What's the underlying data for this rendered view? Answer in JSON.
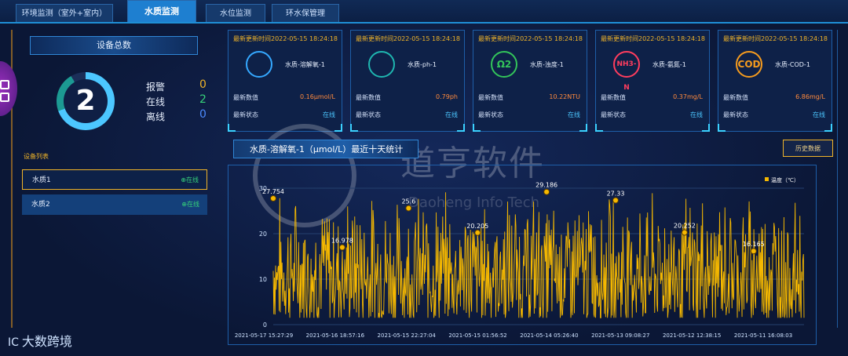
{
  "tabs": [
    {
      "label": "环境监测（室外+室内）",
      "active": false
    },
    {
      "label": "水质监测",
      "active": true
    },
    {
      "label": "水位监测",
      "active": false
    },
    {
      "label": "环水保管理",
      "active": false
    }
  ],
  "left_panel": {
    "title": "设备总数",
    "total": "2",
    "stats": [
      {
        "label": "报警",
        "value": "0",
        "color": "#f0b429"
      },
      {
        "label": "在线",
        "value": "2",
        "color": "#36d27a"
      },
      {
        "label": "离线",
        "value": "0",
        "color": "#4c8bff"
      }
    ],
    "device_list_title": "设备列表",
    "devices": [
      {
        "name": "水质1",
        "status": "在线"
      },
      {
        "name": "水质2",
        "status": "在线"
      }
    ]
  },
  "cards": [
    {
      "time": "最新更新时间2022-05-15 18:24:18",
      "name": "水质-溶解氧-1",
      "icon": "water-drop-icon",
      "icon_text": "",
      "icon_color": "#35a8ff",
      "value_label": "最新数值",
      "value": "0.16μmol/L",
      "status_label": "最新状态",
      "status": "在线"
    },
    {
      "time": "最新更新时间2022-05-15 18:24:18",
      "name": "水质-ph-1",
      "icon": "ph-icon",
      "icon_text": "",
      "icon_color": "#1fb6b0",
      "value_label": "最新数值",
      "value": "0.79ph",
      "status_label": "最新状态",
      "status": "在线"
    },
    {
      "time": "最新更新时间2022-05-15 18:24:18",
      "name": "水质-浊度-1",
      "icon": "turbidity-icon",
      "icon_text": "Ω2",
      "icon_color": "#33c45a",
      "value_label": "最新数值",
      "value": "10.22NTU",
      "status_label": "最新状态",
      "status": "在线"
    },
    {
      "time": "最新更新时间2022-05-15 18:24:18",
      "name": "水质-氨氮-1",
      "icon": "ammonia-icon",
      "icon_text": "NH3-N",
      "icon_color": "#ff3d5e",
      "value_label": "最新数值",
      "value": "0.37mg/L",
      "status_label": "最新状态",
      "status": "在线"
    },
    {
      "time": "最新更新时间2022-05-15 18:24:18",
      "name": "水质-COD-1",
      "icon": "cod-icon",
      "icon_text": "COD",
      "icon_color": "#f59b1e",
      "value_label": "最新数值",
      "value": "6.86mg/L",
      "status_label": "最新状态",
      "status": "在线"
    }
  ],
  "chart_title": "水质-溶解氧-1（μmol/L）最近十天统计",
  "history_button": "历史数据",
  "watermark": {
    "main": "道亨软件",
    "sub": "Daoheng Info Tech"
  },
  "brand": {
    "logo": "ⅠⅭ",
    "text": "大数跨境"
  },
  "chart_data": {
    "type": "area",
    "legend": [
      "温度（℃）"
    ],
    "legend_position": "top-right",
    "ylim": [
      0,
      30
    ],
    "yticks": [
      0,
      10,
      20,
      30
    ],
    "xtick_labels": [
      "2021-05-17 15:27:29",
      "2021-05-16 18:57:16",
      "2021-05-15 22:27:04",
      "2021-05-15 01:56:52",
      "2021-05-14 05:26:40",
      "2021-05-13 09:08:27",
      "2021-05-12 12:38:15",
      "2021-05-11 16:08:03"
    ],
    "annotations": [
      {
        "label": "27.754",
        "x_frac": 0.0,
        "y": 27.754
      },
      {
        "label": "16.978",
        "x_frac": 0.13,
        "y": 16.978
      },
      {
        "label": "25.6",
        "x_frac": 0.255,
        "y": 25.6
      },
      {
        "label": "20.205",
        "x_frac": 0.385,
        "y": 20.205
      },
      {
        "label": "29.186",
        "x_frac": 0.515,
        "y": 29.186
      },
      {
        "label": "27.33",
        "x_frac": 0.645,
        "y": 27.33
      },
      {
        "label": "20.252",
        "x_frac": 0.775,
        "y": 20.252
      },
      {
        "label": "16.165",
        "x_frac": 0.905,
        "y": 16.165
      }
    ],
    "series_range": [
      0,
      30
    ],
    "color": "#f5b800",
    "grid": true
  }
}
